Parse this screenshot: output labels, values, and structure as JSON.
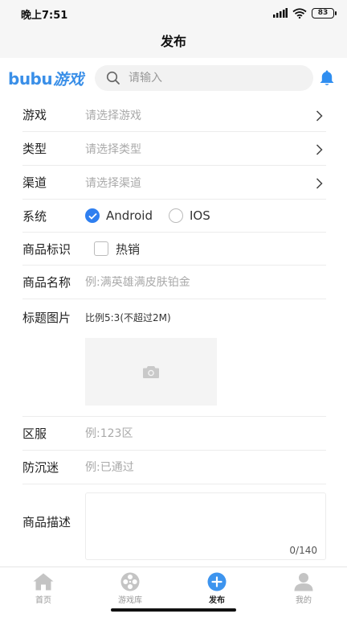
{
  "status_bar": {
    "time": "晚上7:51",
    "battery": "83"
  },
  "header": {
    "title": "发布"
  },
  "brand": {
    "latin": "bubu",
    "cn": "游戏"
  },
  "search": {
    "placeholder": "请输入"
  },
  "form": {
    "game": {
      "label": "游戏",
      "placeholder": "请选择游戏"
    },
    "type": {
      "label": "类型",
      "placeholder": "请选择类型"
    },
    "channel": {
      "label": "渠道",
      "placeholder": "请选择渠道"
    },
    "system": {
      "label": "系统",
      "options": [
        "Android",
        "IOS"
      ],
      "selected": "Android"
    },
    "tag": {
      "label": "商品标识",
      "option": "热销",
      "checked": false
    },
    "name": {
      "label": "商品名称",
      "placeholder": "例:满英雄满皮肤铂金"
    },
    "image": {
      "label": "标题图片",
      "hint": "比例5:3(不超过2M)"
    },
    "server": {
      "label": "区服",
      "placeholder": "例:123区"
    },
    "anti_addiction": {
      "label": "防沉迷",
      "placeholder": "例:已通过"
    },
    "description": {
      "label": "商品描述",
      "counter": "0/140"
    }
  },
  "tabs": [
    {
      "label": "首页",
      "icon": "home-icon"
    },
    {
      "label": "游戏库",
      "icon": "film-reel-icon"
    },
    {
      "label": "发布",
      "icon": "plus-icon",
      "active": true
    },
    {
      "label": "我的",
      "icon": "user-icon"
    }
  ],
  "colors": {
    "accent": "#2f7ff0",
    "brand": "#3a8fe8"
  }
}
